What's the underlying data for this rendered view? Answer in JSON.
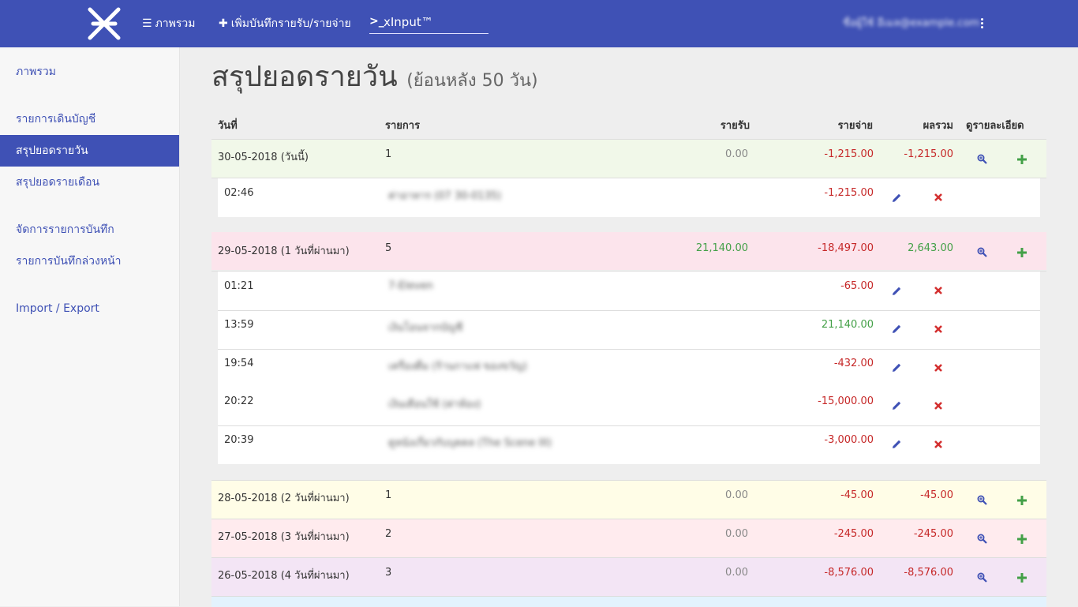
{
  "navbar": {
    "overview_label": "ภาพรวม",
    "add_label": "เพิ่มบันทึกรายรับ/รายจ่าย",
    "xinput_prompt": ">_",
    "xinput_value": "xInput™",
    "user_name": "ชื่อผู้ใช้ อีเมล@example.com"
  },
  "sidebar": {
    "items": [
      {
        "label": "ภาพรวม"
      },
      {
        "label": "รายการเดินบัญชี"
      },
      {
        "label": "สรุปยอดรายวัน"
      },
      {
        "label": "สรุปยอดรายเดือน"
      },
      {
        "label": "จัดการรายการบันทึก"
      },
      {
        "label": "รายการบันทึกล่วงหน้า"
      },
      {
        "label": "Import / Export"
      }
    ]
  },
  "page": {
    "title": "สรุปยอดรายวัน",
    "subtitle": "(ย้อนหลัง 50 วัน)"
  },
  "table": {
    "headers": {
      "date": "วันที่",
      "item": "รายการ",
      "income": "รายรับ",
      "expense": "รายจ่าย",
      "total": "ผลรวม",
      "details": "ดูรายละเอียด"
    },
    "days": [
      {
        "date": "30-05-2018",
        "relative": "(วันนี้)",
        "count": "1",
        "income": "0.00",
        "expense": "-1,215.00",
        "total": "-1,215.00",
        "bg": "#f1f8e9"
      },
      {
        "date": "29-05-2018",
        "relative": "(1 วันที่ผ่านมา)",
        "count": "5",
        "income": "21,140.00",
        "expense": "-18,497.00",
        "total": "2,643.00",
        "bg": "#fce4ec"
      },
      {
        "date": "28-05-2018",
        "relative": "(2 วันที่ผ่านมา)",
        "count": "1",
        "income": "0.00",
        "expense": "-45.00",
        "total": "-45.00",
        "bg": "#fffde7"
      },
      {
        "date": "27-05-2018",
        "relative": "(3 วันที่ผ่านมา)",
        "count": "2",
        "income": "0.00",
        "expense": "-245.00",
        "total": "-245.00",
        "bg": "#ffebee"
      },
      {
        "date": "26-05-2018",
        "relative": "(4 วันที่ผ่านมา)",
        "count": "3",
        "income": "0.00",
        "expense": "-8,576.00",
        "total": "-8,576.00",
        "bg": "#f3e5f5"
      }
    ],
    "day0_entries": [
      {
        "time": "02:46",
        "desc": "ค่าอาหาร (07 30-0135)",
        "amount": "-1,215.00",
        "type": "expense"
      }
    ],
    "day1_entries": [
      {
        "time": "01:21",
        "desc": "7-Eleven",
        "amount": "-65.00",
        "type": "expense"
      },
      {
        "time": "13:59",
        "desc": "เงินโอนจากบัญชี",
        "amount": "21,140.00",
        "type": "income"
      },
      {
        "time": "19:54",
        "desc": "เครื่องดื่ม (ร้านกาแฟ ของขวัญ)",
        "amount": "-432.00",
        "type": "expense"
      },
      {
        "time": "20:22",
        "desc": "เงินเดือนใช้ (ค่าห้อง)",
        "amount": "-15,000.00",
        "type": "expense"
      },
      {
        "time": "20:39",
        "desc": "ดูหนังเกี่ยวกับบุคคล (The Scene III)",
        "amount": "-3,000.00",
        "type": "expense"
      }
    ]
  },
  "colors": {
    "primary": "#3f51b5",
    "negative": "#c62828",
    "positive": "#43a047",
    "delete": "#d32f2f",
    "add": "#43a047"
  }
}
